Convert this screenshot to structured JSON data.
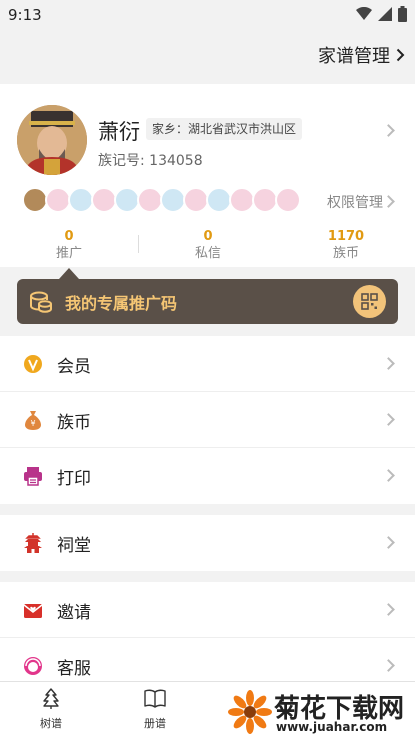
{
  "status": {
    "time": "9:13"
  },
  "header": {
    "manage_label": "家谱管理"
  },
  "profile": {
    "name": "萧衍",
    "hometown": "家乡：湖北省武汉市洪山区",
    "clan_id": "族记号: 134058",
    "permission_label": "权限管理"
  },
  "stats": [
    {
      "value": "0",
      "label": "推广"
    },
    {
      "value": "0",
      "label": "私信"
    },
    {
      "value": "1170",
      "label": "族币"
    }
  ],
  "promo": {
    "label": "我的专属推广码"
  },
  "menu1": [
    {
      "label": "会员",
      "icon": "vip-icon"
    },
    {
      "label": "族币",
      "icon": "money-bag-icon"
    },
    {
      "label": "打印",
      "icon": "printer-icon"
    }
  ],
  "menu2": [
    {
      "label": "祠堂",
      "icon": "pagoda-icon"
    }
  ],
  "menu3": [
    {
      "label": "邀请",
      "icon": "envelope-icon"
    },
    {
      "label": "客服",
      "icon": "headset-icon"
    }
  ],
  "tabs": [
    {
      "label": "树谱",
      "icon": "tree-icon"
    },
    {
      "label": "册谱",
      "icon": "book-icon"
    }
  ],
  "watermark": {
    "title": "菊花下载网",
    "url": "www.juahar.com"
  },
  "colors": {
    "accent": "#e19a12",
    "promo_bg": "#5a5048",
    "promo_text": "#f5c674"
  }
}
